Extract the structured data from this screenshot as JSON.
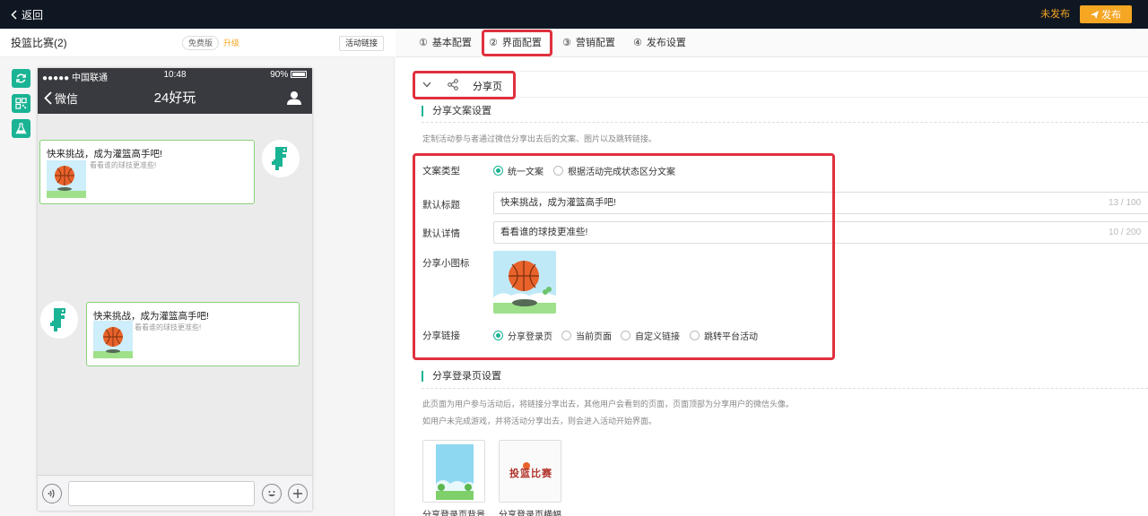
{
  "topbar": {
    "back_label": "返回",
    "status_label": "未发布",
    "publish_label": "发布",
    "accent": "#f5a623"
  },
  "left": {
    "game_title": "投篮比赛(2)",
    "free_tag": "免费版",
    "upgrade_label": "升级",
    "activity_link_label": "活动链接",
    "tools": [
      "refresh-icon",
      "qrcode-icon",
      "flask-icon"
    ]
  },
  "phone": {
    "carrier": "●●●●● 中国联通",
    "time": "10:48",
    "battery": "90%",
    "back_label": "微信",
    "title": "24好玩",
    "messages": [
      {
        "title": "快来挑战，成为灌篮高手吧!",
        "desc": "看看谁的球技更准些!"
      },
      {
        "title": "快来挑战，成为灌篮高手吧!",
        "desc": "看看谁的球技更准些!"
      }
    ]
  },
  "tabs": [
    {
      "num": "①",
      "label": "基本配置"
    },
    {
      "num": "②",
      "label": "界面配置"
    },
    {
      "num": "③",
      "label": "营销配置"
    },
    {
      "num": "④",
      "label": "发布设置"
    }
  ],
  "share_page": {
    "title": "分享页",
    "copy_section_title": "分享文案设置",
    "copy_hint": "定制活动参与者通过微信分享出去后的文案、图片以及跳转链接。",
    "copy_type_label": "文案类型",
    "copy_type_options": [
      "统一文案",
      "根据活动完成状态区分文案"
    ],
    "default_title_label": "默认标题",
    "default_title_value": "快来挑战，成为灌篮高手吧!",
    "default_title_count": "13 / 100",
    "default_detail_label": "默认详情",
    "default_detail_value": "看看谁的球技更准些!",
    "default_detail_count": "10 / 200",
    "icon_label": "分享小图标",
    "link_label": "分享链接",
    "link_options": [
      "分享登录页",
      "当前页面",
      "自定义链接",
      "跳转平台活动"
    ],
    "login_section_title": "分享登录页设置",
    "login_hint1": "此页面为用户参与活动后，将链接分享出去，其他用户会看到的页面，页面顶部为分享用户的微信头像。",
    "login_hint2": "如用户未完成游戏，并将活动分享出去，则会进入活动开始界面。",
    "login_bg_caption": "分享登录页背景",
    "login_banner_caption": "分享登录页横幅",
    "banner_text": "投篮比赛"
  },
  "colors": {
    "primary": "#1ab394",
    "highlight": "#e0303e",
    "topbar": "#0f1722"
  }
}
